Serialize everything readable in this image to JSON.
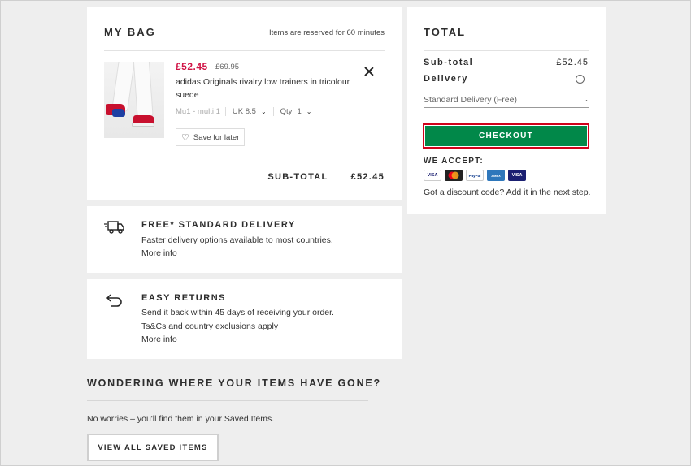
{
  "bag": {
    "title": "MY BAG",
    "reserve_note": "Items are reserved for 60 minutes",
    "item": {
      "price_now": "£52.45",
      "price_was": "£69.95",
      "name": "adidas Originals rivalry low trainers in tricolour suede",
      "color": "Mu1 - multi 1",
      "size": "UK 8.5",
      "qty_label": "Qty",
      "qty_value": "1",
      "save_later": "Save for later"
    },
    "subtotal_label": "SUB-TOTAL",
    "subtotal_value": "£52.45"
  },
  "delivery_info": {
    "title": "FREE* STANDARD DELIVERY",
    "text": "Faster delivery options available to most countries.",
    "link": "More info"
  },
  "returns_info": {
    "title": "EASY RETURNS",
    "text1": "Send it back within 45 days of receiving your order.",
    "text2": "Ts&Cs and country exclusions apply",
    "link": "More info"
  },
  "saved": {
    "title": "WONDERING WHERE YOUR ITEMS HAVE GONE?",
    "text": "No worries – you'll find them in your Saved Items.",
    "button": "VIEW ALL SAVED ITEMS"
  },
  "total": {
    "title": "TOTAL",
    "subtotal_label": "Sub-total",
    "subtotal_value": "£52.45",
    "delivery_label": "Delivery",
    "delivery_option": "Standard Delivery (Free)",
    "checkout": "CHECKOUT",
    "we_accept": "WE ACCEPT:",
    "payment_methods": [
      "VISA",
      "Mastercard",
      "PayPal",
      "American Express",
      "Visa Electron"
    ],
    "discount_text": "Got a discount code? Add it in the next step."
  },
  "colors": {
    "sale_red": "#d01345",
    "checkout_green": "#018849",
    "focus_red": "#d0021b"
  }
}
